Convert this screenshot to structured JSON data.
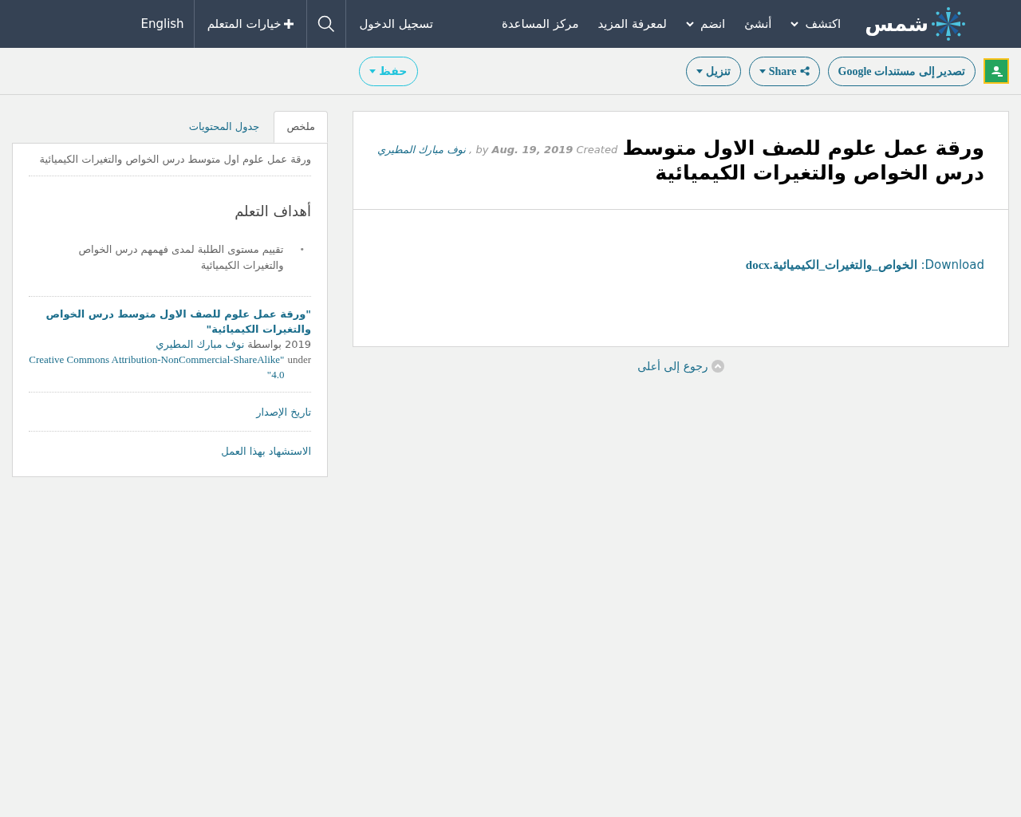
{
  "header": {
    "logo": "شمس",
    "nav": [
      {
        "label": "اكتشف",
        "dropdown": true
      },
      {
        "label": "أنشئ",
        "dropdown": false
      },
      {
        "label": "انضم",
        "dropdown": true
      },
      {
        "label": "لمعرفة المزيد",
        "dropdown": false
      },
      {
        "label": "مركز المساعدة",
        "dropdown": false
      }
    ],
    "login": "تسجيل الدخول",
    "learner_options": "خيارات المتعلم",
    "language": "English"
  },
  "toolbar": {
    "buttons": [
      {
        "label": "تصدير إلى مستندات Google",
        "kind": "plain"
      },
      {
        "label": "Share",
        "kind": "share"
      },
      {
        "label": "تنزيل",
        "kind": "dropdown"
      }
    ],
    "save": "حفظ"
  },
  "main": {
    "title": "ورقة عمل علوم للصف الاول متوسط درس الخواص والتغيرات الكيميائية",
    "byline": {
      "by": "by",
      "date": "Aug. 19, 2019",
      "created": "Created",
      "separator": ",",
      "author": "نوف مبارك المطيري"
    },
    "download_label": "Download:",
    "download_file": "الخواص_والتغيرات_الكيميائية.docx",
    "back_to_top": "رجوع إلى أعلى"
  },
  "sidebar": {
    "tabs": [
      {
        "label": "ملخص",
        "selected": true
      },
      {
        "label": "جدول المحتويات",
        "selected": false
      }
    ],
    "summary": "ورقة عمل علوم اول متوسط درس الخواص والتغيرات الكيميائية",
    "objectives_title": "أهداف التعلم",
    "bullet": "•",
    "objectives": [
      "تقييم مستوى الطلبة لمدى فهمهم درس الخواص والتغيرات الكيميائية"
    ],
    "attribution": {
      "title": "\"ورقة عمل علوم للصف الاول متوسط درس الخواص والتغيرات الكيميائية\"",
      "year_by": "2019 بواسطة",
      "author": "نوف مبارك المطيري",
      "under": "under",
      "license": "\"Creative Commons Attribution-NonCommercial-ShareAlike 4.0\""
    },
    "links": [
      "تاريخ الإصدار",
      "الاستشهاد بهذا العمل"
    ]
  }
}
